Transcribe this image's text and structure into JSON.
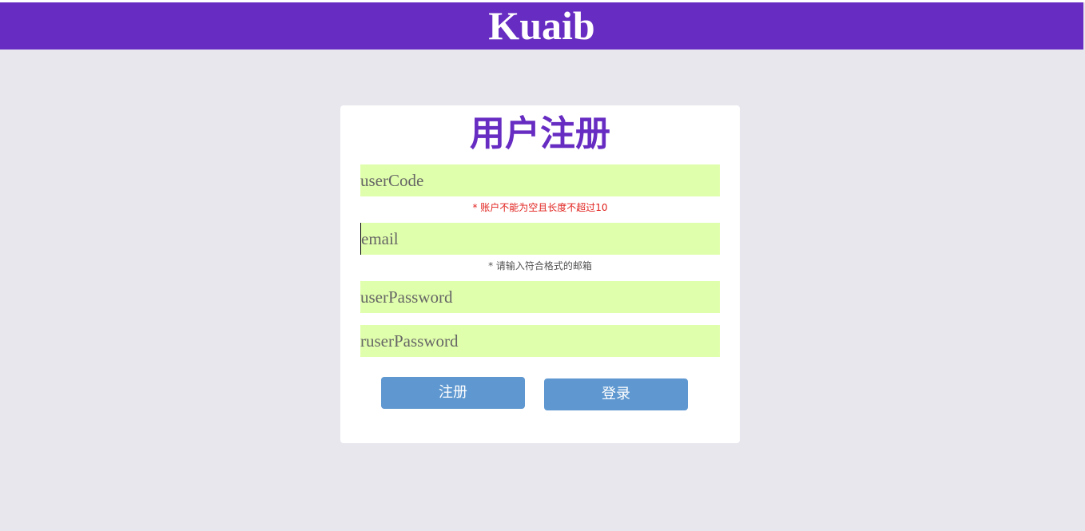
{
  "header": {
    "brand": "Kuaib",
    "background": "#672cc2"
  },
  "form": {
    "title": "用户注册",
    "fields": {
      "user_code": {
        "placeholder": "userCode",
        "value": ""
      },
      "email": {
        "placeholder": "email",
        "value": ""
      },
      "user_password": {
        "placeholder": "userPassword",
        "value": ""
      },
      "ruser_password": {
        "placeholder": "ruserPassword",
        "value": ""
      }
    },
    "hints": {
      "user_code": "* 账户不能为空且长度不超过10",
      "email": "* 请输入符合格式的邮箱"
    },
    "buttons": {
      "register": "注册",
      "login": "登录"
    }
  },
  "colors": {
    "page_background": "#e8e7ee",
    "accent": "#672cc2",
    "field_background": "#e0ffac",
    "button_background": "#5f98d0",
    "error_text": "#e0201c"
  }
}
